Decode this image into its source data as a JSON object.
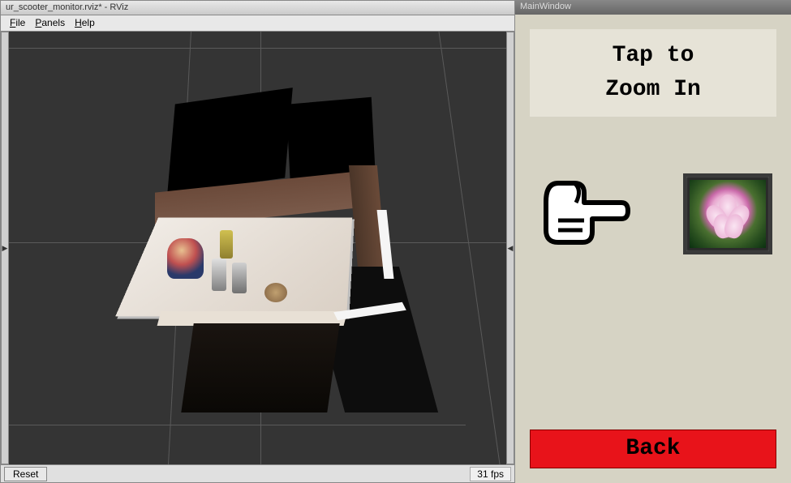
{
  "rviz": {
    "title": "ur_scooter_monitor.rviz* - RViz",
    "menu": {
      "file": "File",
      "panels": "Panels",
      "help": "Help"
    },
    "reset_label": "Reset",
    "fps": "31 fps"
  },
  "mainwindow": {
    "title": "MainWindow",
    "tap_line1": "Tap to",
    "tap_line2": "Zoom In",
    "back_label": "Back"
  },
  "icons": {
    "hand": "pointing-hand-icon",
    "thumbnail": "flower-thumbnail"
  },
  "colors": {
    "back_button": "#e8131a",
    "panel_bg": "#d6d3c4",
    "viewport_bg": "#343434"
  }
}
